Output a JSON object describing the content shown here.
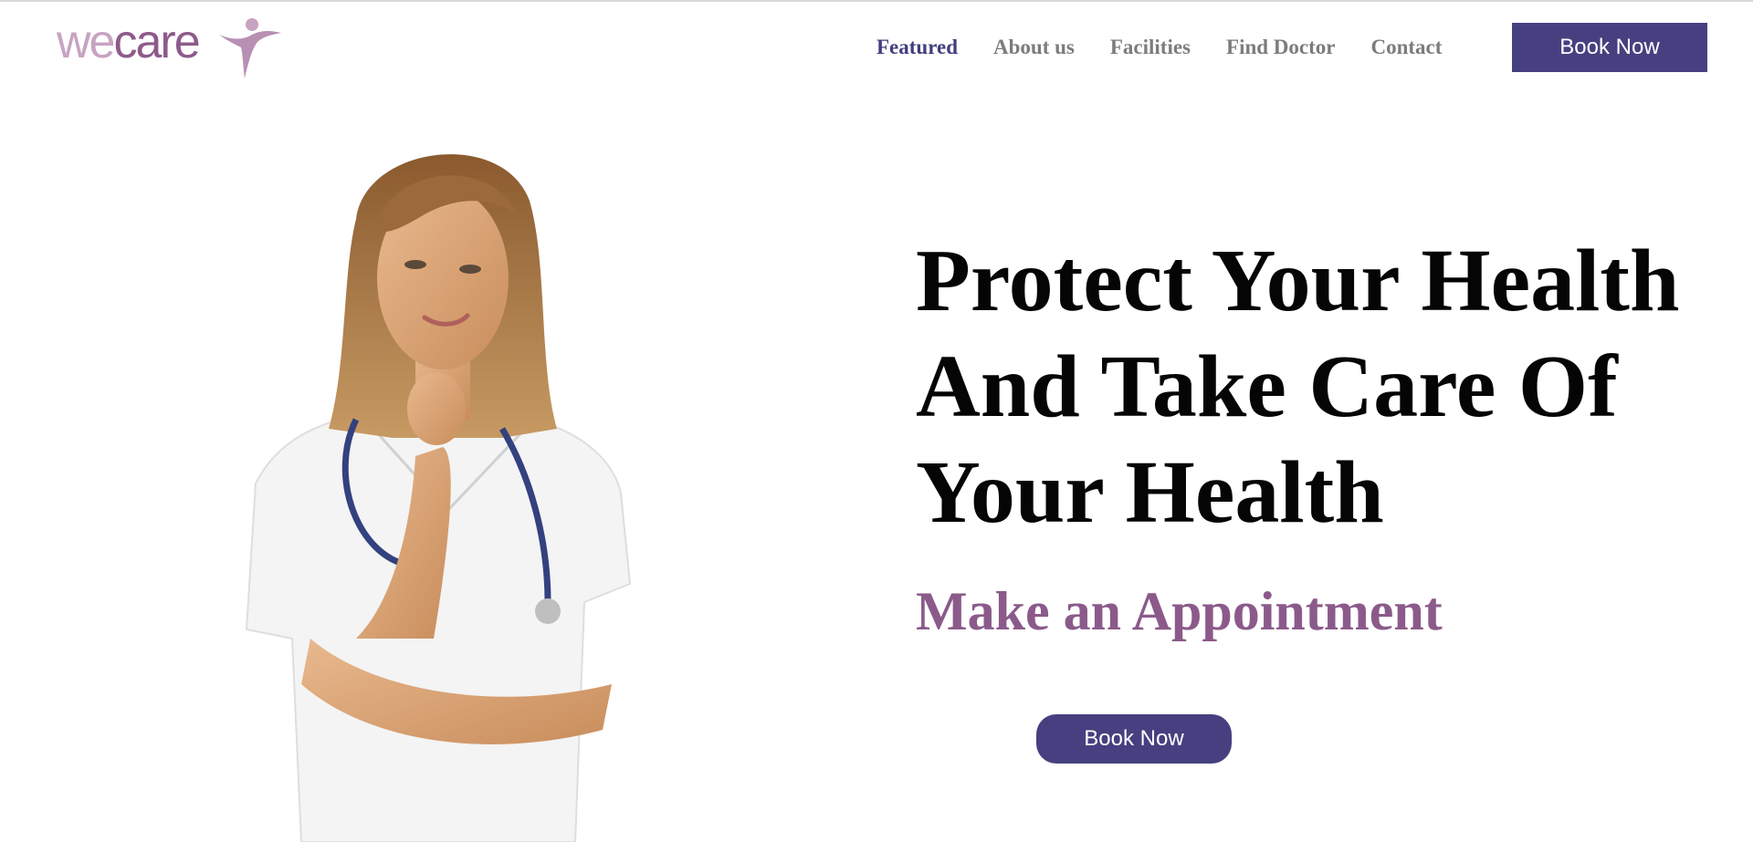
{
  "brand": {
    "logo_we": "we",
    "logo_care": "care"
  },
  "nav": {
    "items": [
      {
        "label": "Featured",
        "active": true
      },
      {
        "label": "About us",
        "active": false
      },
      {
        "label": "Facilities",
        "active": false
      },
      {
        "label": "Find Doctor",
        "active": false
      },
      {
        "label": "Contact",
        "active": false
      }
    ],
    "book_label": "Book Now"
  },
  "hero": {
    "headline_lines": [
      "Protect Your Health",
      "And Take Care Of",
      "Your Health"
    ],
    "subhead": "Make an Appointment",
    "book_label": "Book Now",
    "image": "doctor-photo"
  },
  "colors": {
    "accent": "#464080",
    "subhead": "#8b5a8a",
    "nav_active": "#3f3f7e",
    "nav_inactive": "#7c7c7c",
    "logo": "#9a6f95"
  }
}
